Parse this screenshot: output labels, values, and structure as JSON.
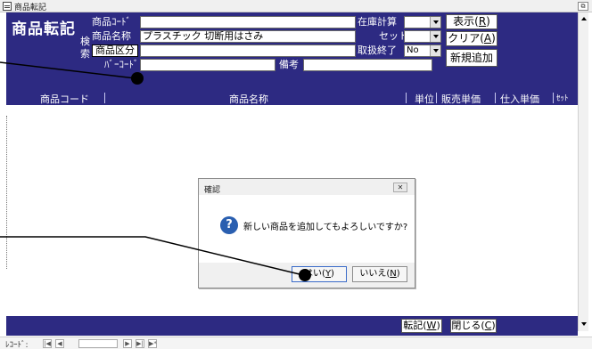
{
  "window": {
    "title": "商品転記",
    "restore_glyph": "⧉"
  },
  "form": {
    "title": "商品転記",
    "search_tag": "検索",
    "fields": {
      "code_label": "商品ｺｰﾄﾞ",
      "code_value": "",
      "name_label": "商品名称",
      "name_value": "プラスチック 切断用はさみ",
      "category_label": "商品区分",
      "category_value": "",
      "barcode_label": "ﾊﾞｰｺｰﾄﾞ",
      "barcode_value": "",
      "remarks_label": "備考",
      "remarks_value": "",
      "stock_calc_label": "在庫計算",
      "stock_calc_value": "",
      "set_label": "セット",
      "set_value": "",
      "discontinued_label": "取扱終了",
      "discontinued_value": "No"
    },
    "buttons": {
      "show_text": "表示(",
      "show_key": "R",
      "clear_text": "クリア(",
      "clear_key": "A",
      "add_new": "新規追加",
      "close_paren": ")"
    }
  },
  "table": {
    "columns": [
      "商品コード",
      "商品名称",
      "単位",
      "販売単価",
      "仕入単価",
      "ｾｯﾄ"
    ]
  },
  "footer": {
    "transfer_text": "転記(",
    "transfer_key": "W",
    "close_text": "閉じる(",
    "close_key": "C",
    "close_paren": ")"
  },
  "record_nav": {
    "label": "ﾚｺｰﾄﾞ:",
    "first": "|◀",
    "prev": "◀",
    "next": "▶",
    "last": "▶|",
    "new": "▶*"
  },
  "dialog": {
    "title": "確認",
    "close_glyph": "✕",
    "icon_glyph": "?",
    "message": "新しい商品を追加してもよろしいですか?",
    "yes_text": "はい(",
    "yes_key": "Y",
    "no_text": "いいえ(",
    "no_key": "N",
    "paren_close": ")"
  },
  "colors": {
    "header_bg": "#2d2a82",
    "annotation": "#000000"
  }
}
